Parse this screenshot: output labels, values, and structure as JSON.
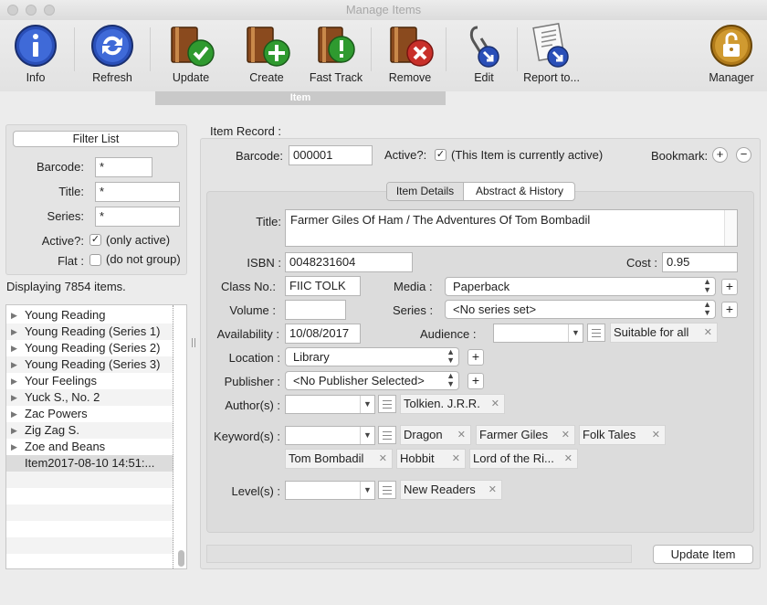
{
  "window": {
    "title": "Manage Items"
  },
  "toolbar": {
    "buttons": [
      {
        "label": "Info",
        "icon": "info-icon"
      },
      {
        "label": "Refresh",
        "icon": "refresh-icon"
      },
      {
        "label": "Update",
        "icon": "update-icon"
      },
      {
        "label": "Create",
        "icon": "create-icon"
      },
      {
        "label": "Fast Track",
        "icon": "fast-track-icon"
      },
      {
        "label": "Remove",
        "icon": "remove-icon"
      },
      {
        "label": "Edit",
        "icon": "edit-icon"
      },
      {
        "label": "Report to...",
        "icon": "report-icon"
      },
      {
        "label": "Manager",
        "icon": "lock-icon"
      }
    ],
    "group_label": "Item"
  },
  "filter": {
    "title": "Filter List",
    "barcode_label": "Barcode:",
    "title_label": "Title:",
    "series_label": "Series:",
    "active_label": "Active?:",
    "active_note": "(only active)",
    "flat_label": "Flat :",
    "flat_note": "(do not group)",
    "wildcard": "*"
  },
  "list": {
    "count_text": "Displaying 7854 items.",
    "rows": [
      {
        "text": "Young Reading",
        "expandable": true
      },
      {
        "text": "Young Reading (Series 1)",
        "expandable": true
      },
      {
        "text": "Young Reading (Series 2)",
        "expandable": true
      },
      {
        "text": "Young Reading (Series 3)",
        "expandable": true
      },
      {
        "text": "Your Feelings",
        "expandable": true
      },
      {
        "text": "Yuck S., No. 2",
        "expandable": true
      },
      {
        "text": "Zac Powers",
        "expandable": true
      },
      {
        "text": "Zig Zag S.",
        "expandable": true
      },
      {
        "text": "Zoe and Beans",
        "expandable": true
      },
      {
        "text": "Item2017-08-10 14:51:...",
        "expandable": false,
        "selected": true
      }
    ]
  },
  "record": {
    "heading": "Item Record :",
    "barcode_label": "Barcode:",
    "barcode": "000001",
    "active_label": "Active?:",
    "active_note": "(This Item is currently active)",
    "bookmark_label": "Bookmark:",
    "tabs": [
      "Item Details",
      "Abstract & History"
    ],
    "title_label": "Title:",
    "title": "Farmer Giles Of Ham / The Adventures Of Tom Bombadil",
    "isbn_label": "ISBN :",
    "isbn": "0048231604",
    "cost_label": "Cost :",
    "cost": "0.95",
    "class_label": "Class No.:",
    "class_no": "FIIC TOLK",
    "media_label": "Media :",
    "media": "Paperback",
    "volume_label": "Volume :",
    "series_label": "Series :",
    "series": "<No series set>",
    "availability_label": "Availability :",
    "availability": "10/08/2017",
    "audience_label": "Audience :",
    "audience_tag": "Suitable for all",
    "location_label": "Location :",
    "location": "Library",
    "publisher_label": "Publisher :",
    "publisher": "<No Publisher Selected>",
    "authors_label": "Author(s) :",
    "authors": [
      "Tolkien. J.R.R."
    ],
    "keywords_label": "Keyword(s) :",
    "keywords": [
      "Dragon",
      "Farmer Giles",
      "Folk Tales",
      "Tom Bombadil",
      "Hobbit",
      "Lord of the Ri..."
    ],
    "levels_label": "Level(s) :",
    "levels": [
      "New Readers"
    ],
    "update_button": "Update Item"
  }
}
